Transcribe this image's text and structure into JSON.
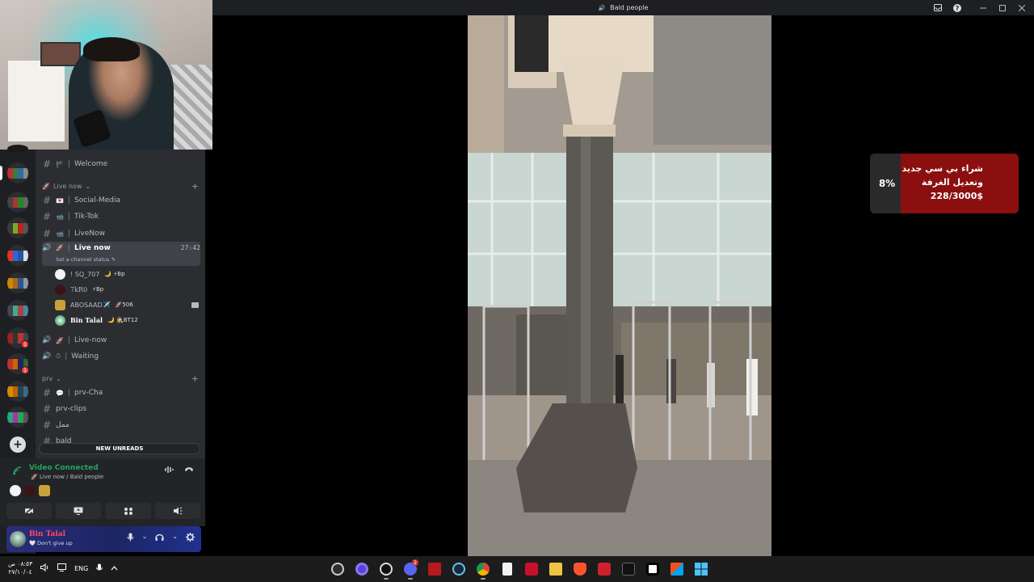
{
  "window": {
    "title": "Bald people"
  },
  "title_controls": [
    "inbox-icon",
    "help-icon",
    "minimize-icon",
    "maximize-icon",
    "close-icon"
  ],
  "channels": {
    "welcome": {
      "name": "Welcome"
    },
    "category_live": {
      "label": "Live now"
    },
    "social": {
      "name": "Social-Media"
    },
    "tiktok": {
      "name": "Tik-Tok"
    },
    "livenow_text": {
      "name": "LiveNow"
    },
    "live_voice": {
      "name": "Live now",
      "timer": "27:42",
      "status_hint": "Set a channel status"
    },
    "users": [
      {
        "name": "! SQ_707",
        "extra": "🌙 ⚡Bp"
      },
      {
        "name": "7kR0",
        "extra": "⚡Bp"
      },
      {
        "name": "ABOSAAD✈️",
        "extra": "🚀506"
      },
      {
        "name": "Bin Talal",
        "extra": "🌙 🕵BT12"
      }
    ],
    "live_now_voice": {
      "name": "Live-now"
    },
    "waiting": {
      "name": "Waiting"
    },
    "category_prv": {
      "label": "prv"
    },
    "prv_cha": {
      "name": "prv-Cha"
    },
    "prv_clips": {
      "name": "prv-clips"
    },
    "arabic_ch": {
      "name": "ممل"
    },
    "bald_ch": {
      "name": "bald"
    },
    "new_unreads": "NEW UNREADS"
  },
  "voice": {
    "title": "Video Connected",
    "subtitle": "Live now / Bald people"
  },
  "user_panel": {
    "name": "Bin Talal",
    "status": "Don't give up"
  },
  "donation": {
    "percent": "8%",
    "progress": 0.08,
    "text": "شراء بي سي جديد وتعديل الغرفة",
    "amount": "228/3000$"
  },
  "taskbar": {
    "time": "٠٨:٥٣ ص",
    "date": "٢٧/١٠/٠٤",
    "lang": "ENG",
    "discord_badge": "2"
  },
  "colors": {
    "accent_green": "#23a55a",
    "donation_red": "#8b0f0f",
    "rail_bg": "#1e1f22",
    "channels_bg": "#2b2d31"
  }
}
